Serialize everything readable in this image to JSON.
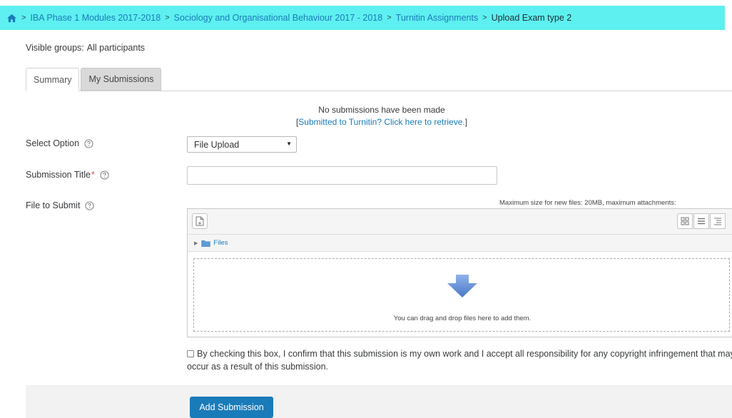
{
  "breadcrumb": {
    "items": [
      "IBA Phase 1 Modules 2017-2018",
      "Sociology and Organisational Behaviour 2017 - 2018",
      "Turnitin Assignments",
      "Upload Exam type 2"
    ],
    "separator": ">"
  },
  "groups": {
    "label": "Visible groups:",
    "value": "All participants"
  },
  "tabs": {
    "summary": "Summary",
    "submissions": "My Submissions"
  },
  "status": {
    "message": "No submissions have been made",
    "retrieve_open": "[",
    "retrieve_link": "Submitted to Turnitin? Click here to retrieve.",
    "retrieve_close": "]"
  },
  "form": {
    "select_option_label": "Select Option",
    "select_option_value": "File Upload",
    "title_label": "Submission Title",
    "title_required": "*",
    "title_value": "",
    "file_label": "File to Submit"
  },
  "filepicker": {
    "max_size_text": "Maximum size for new files: 20MB, maximum attachments:",
    "path_label": "Files",
    "drop_text": "You can drag and drop files here to add them."
  },
  "confirm_text": "By checking this box, I confirm that this submission is my own work and I accept all responsibility for any copyright infringement that may occur as a result of this submission.",
  "submit_label": "Add Submission",
  "colors": {
    "accent": "#1a7bb9",
    "breadcrumb_bg": "#5ef0f0",
    "required": "#d9534f"
  }
}
